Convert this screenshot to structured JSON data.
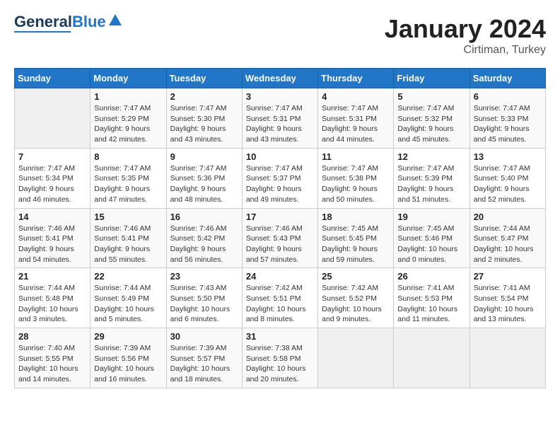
{
  "header": {
    "logo_general": "General",
    "logo_blue": "Blue",
    "month": "January 2024",
    "location": "Cirtiman, Turkey"
  },
  "days_of_week": [
    "Sunday",
    "Monday",
    "Tuesday",
    "Wednesday",
    "Thursday",
    "Friday",
    "Saturday"
  ],
  "weeks": [
    [
      {
        "day": "",
        "info": ""
      },
      {
        "day": "1",
        "info": "Sunrise: 7:47 AM\nSunset: 5:29 PM\nDaylight: 9 hours\nand 42 minutes."
      },
      {
        "day": "2",
        "info": "Sunrise: 7:47 AM\nSunset: 5:30 PM\nDaylight: 9 hours\nand 43 minutes."
      },
      {
        "day": "3",
        "info": "Sunrise: 7:47 AM\nSunset: 5:31 PM\nDaylight: 9 hours\nand 43 minutes."
      },
      {
        "day": "4",
        "info": "Sunrise: 7:47 AM\nSunset: 5:31 PM\nDaylight: 9 hours\nand 44 minutes."
      },
      {
        "day": "5",
        "info": "Sunrise: 7:47 AM\nSunset: 5:32 PM\nDaylight: 9 hours\nand 45 minutes."
      },
      {
        "day": "6",
        "info": "Sunrise: 7:47 AM\nSunset: 5:33 PM\nDaylight: 9 hours\nand 45 minutes."
      }
    ],
    [
      {
        "day": "7",
        "info": "Sunrise: 7:47 AM\nSunset: 5:34 PM\nDaylight: 9 hours\nand 46 minutes."
      },
      {
        "day": "8",
        "info": "Sunrise: 7:47 AM\nSunset: 5:35 PM\nDaylight: 9 hours\nand 47 minutes."
      },
      {
        "day": "9",
        "info": "Sunrise: 7:47 AM\nSunset: 5:36 PM\nDaylight: 9 hours\nand 48 minutes."
      },
      {
        "day": "10",
        "info": "Sunrise: 7:47 AM\nSunset: 5:37 PM\nDaylight: 9 hours\nand 49 minutes."
      },
      {
        "day": "11",
        "info": "Sunrise: 7:47 AM\nSunset: 5:38 PM\nDaylight: 9 hours\nand 50 minutes."
      },
      {
        "day": "12",
        "info": "Sunrise: 7:47 AM\nSunset: 5:39 PM\nDaylight: 9 hours\nand 51 minutes."
      },
      {
        "day": "13",
        "info": "Sunrise: 7:47 AM\nSunset: 5:40 PM\nDaylight: 9 hours\nand 52 minutes."
      }
    ],
    [
      {
        "day": "14",
        "info": "Sunrise: 7:46 AM\nSunset: 5:41 PM\nDaylight: 9 hours\nand 54 minutes."
      },
      {
        "day": "15",
        "info": "Sunrise: 7:46 AM\nSunset: 5:41 PM\nDaylight: 9 hours\nand 55 minutes."
      },
      {
        "day": "16",
        "info": "Sunrise: 7:46 AM\nSunset: 5:42 PM\nDaylight: 9 hours\nand 56 minutes."
      },
      {
        "day": "17",
        "info": "Sunrise: 7:46 AM\nSunset: 5:43 PM\nDaylight: 9 hours\nand 57 minutes."
      },
      {
        "day": "18",
        "info": "Sunrise: 7:45 AM\nSunset: 5:45 PM\nDaylight: 9 hours\nand 59 minutes."
      },
      {
        "day": "19",
        "info": "Sunrise: 7:45 AM\nSunset: 5:46 PM\nDaylight: 10 hours\nand 0 minutes."
      },
      {
        "day": "20",
        "info": "Sunrise: 7:44 AM\nSunset: 5:47 PM\nDaylight: 10 hours\nand 2 minutes."
      }
    ],
    [
      {
        "day": "21",
        "info": "Sunrise: 7:44 AM\nSunset: 5:48 PM\nDaylight: 10 hours\nand 3 minutes."
      },
      {
        "day": "22",
        "info": "Sunrise: 7:44 AM\nSunset: 5:49 PM\nDaylight: 10 hours\nand 5 minutes."
      },
      {
        "day": "23",
        "info": "Sunrise: 7:43 AM\nSunset: 5:50 PM\nDaylight: 10 hours\nand 6 minutes."
      },
      {
        "day": "24",
        "info": "Sunrise: 7:42 AM\nSunset: 5:51 PM\nDaylight: 10 hours\nand 8 minutes."
      },
      {
        "day": "25",
        "info": "Sunrise: 7:42 AM\nSunset: 5:52 PM\nDaylight: 10 hours\nand 9 minutes."
      },
      {
        "day": "26",
        "info": "Sunrise: 7:41 AM\nSunset: 5:53 PM\nDaylight: 10 hours\nand 11 minutes."
      },
      {
        "day": "27",
        "info": "Sunrise: 7:41 AM\nSunset: 5:54 PM\nDaylight: 10 hours\nand 13 minutes."
      }
    ],
    [
      {
        "day": "28",
        "info": "Sunrise: 7:40 AM\nSunset: 5:55 PM\nDaylight: 10 hours\nand 14 minutes."
      },
      {
        "day": "29",
        "info": "Sunrise: 7:39 AM\nSunset: 5:56 PM\nDaylight: 10 hours\nand 16 minutes."
      },
      {
        "day": "30",
        "info": "Sunrise: 7:39 AM\nSunset: 5:57 PM\nDaylight: 10 hours\nand 18 minutes."
      },
      {
        "day": "31",
        "info": "Sunrise: 7:38 AM\nSunset: 5:58 PM\nDaylight: 10 hours\nand 20 minutes."
      },
      {
        "day": "",
        "info": ""
      },
      {
        "day": "",
        "info": ""
      },
      {
        "day": "",
        "info": ""
      }
    ]
  ]
}
